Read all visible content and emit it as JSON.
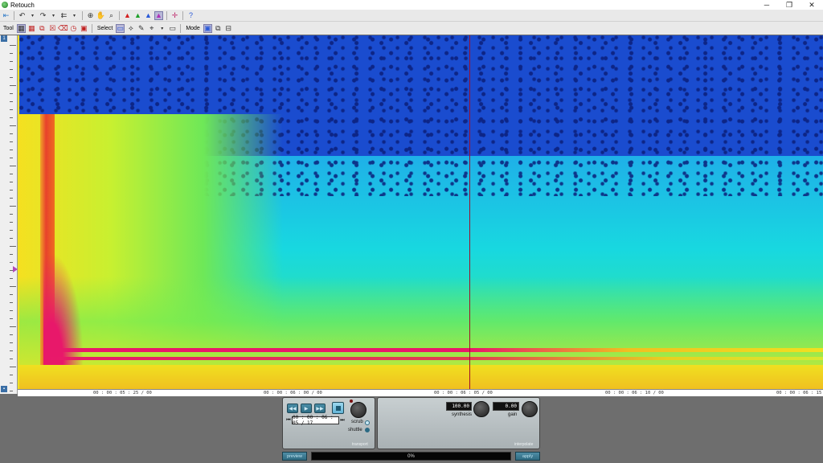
{
  "window": {
    "title": "Retouch",
    "minimize": "─",
    "maximize": "❐",
    "close": "✕"
  },
  "toolbar2": {
    "tool_label": "Tool",
    "select_label": "Select",
    "mode_label": "Mode"
  },
  "timeline": {
    "labels": [
      "00 : 00 : 05 : 25 / 00",
      "00 : 00 : 06 : 00 / 00",
      "00 : 00 : 06 : 05 / 00",
      "00 : 00 : 06 : 10 / 00",
      "00 : 00 : 06 : 15"
    ]
  },
  "transport": {
    "time": "00 : 00 : 06 : 05 / 17",
    "scrub_label": "scrub",
    "shuttle_label": "shuttle",
    "panel_label": "transport",
    "selected_mode": "shuttle"
  },
  "interpolate": {
    "synthesis_value": "100.00",
    "synthesis_label": "synthesis",
    "gain_value": "0.00",
    "gain_label": "gain",
    "panel_label": "interpolate"
  },
  "actions": {
    "preview_label": "preview",
    "progress_text": "0%",
    "progress_value": 0,
    "apply_label": "apply"
  },
  "colors": {
    "spectro_low": "#1a4ccf",
    "spectro_mid": "#18d8e0",
    "spectro_high": "#f0e020",
    "spectro_peak": "#e8186a",
    "cursor": "#a0102a",
    "accent": "#2f6b82"
  }
}
